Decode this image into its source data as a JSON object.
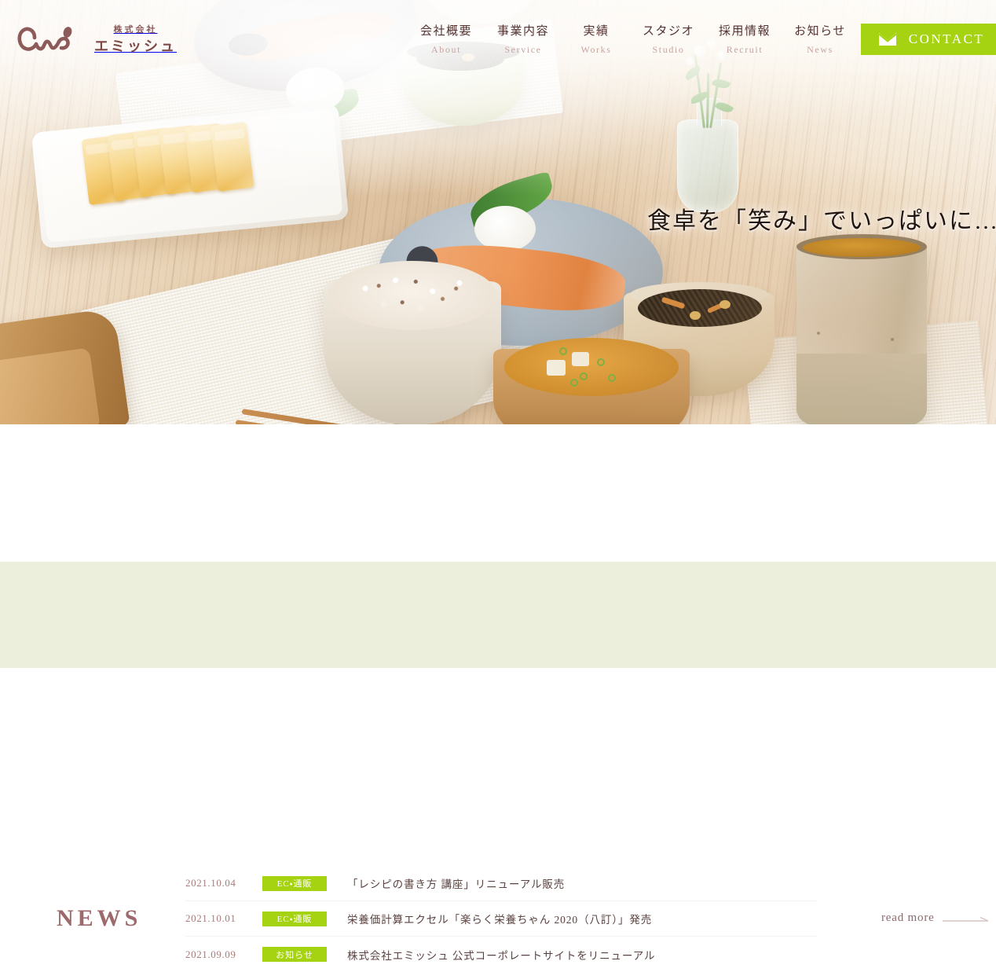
{
  "brand": {
    "logo_mark": "emi-script-logo",
    "kabushiki": "株式会社",
    "name": "エミッシュ"
  },
  "nav": {
    "items": [
      {
        "ja": "会社概要",
        "en": "About",
        "icon": "nav-about"
      },
      {
        "ja": "事業内容",
        "en": "Service",
        "icon": "nav-service"
      },
      {
        "ja": "実績",
        "en": "Works",
        "icon": "nav-works"
      },
      {
        "ja": "スタジオ",
        "en": "Studio",
        "icon": "nav-studio"
      },
      {
        "ja": "採用情報",
        "en": "Recruit",
        "icon": "nav-recruit"
      },
      {
        "ja": "お知らせ",
        "en": "News",
        "icon": "nav-news"
      }
    ],
    "contact": {
      "label": "CONTACT",
      "icon": "envelope-icon",
      "bg_color": "#a5d312",
      "text_color": "#ffffff"
    }
  },
  "hero": {
    "tagline": "食卓を「笑み」でいっぱいに…",
    "image_alt": "和朝食の食卓（焼き鮭・卵焼き・雑穀ご飯・味噌汁・ひじき煮・お茶）"
  },
  "news": {
    "heading": "NEWS",
    "heading_color": "#9c6a6c",
    "badge_color": "#a5d312",
    "items": [
      {
        "date": "2021.10.04",
        "category": "EC・通販",
        "title": "「レシピの書き方 講座」リニューアル販売"
      },
      {
        "date": "2021.10.01",
        "category": "EC・通販",
        "title": "栄養価計算エクセル「楽らく栄養ちゃん 2020（八訂）」発売"
      },
      {
        "date": "2021.09.09",
        "category": "お知らせ",
        "title": "株式会社エミッシュ 公式コーポレートサイトをリニューアル"
      }
    ],
    "read_more": {
      "label": "read more",
      "icon": "arrow-right-icon"
    }
  },
  "footer_band": {
    "bg_color": "#edefdd"
  }
}
